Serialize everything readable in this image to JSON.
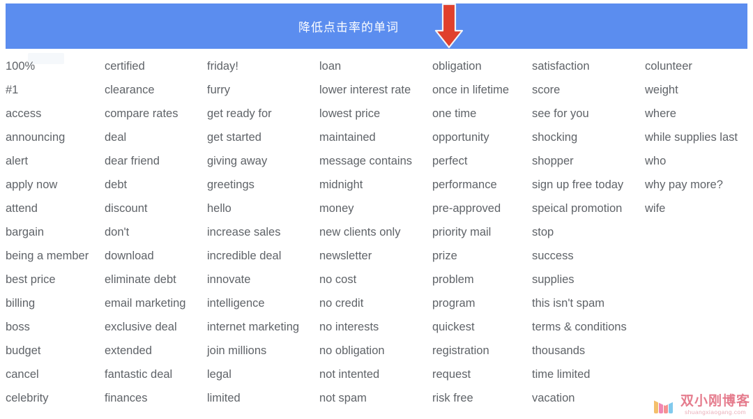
{
  "header": {
    "title": "降低点击率的单词",
    "banner_color": "#5b8def",
    "arrow_color": "#e0402c",
    "arrow_icon": "arrow-down-icon",
    "title_color": "#ffffff"
  },
  "word_list": {
    "text_color": "#5f6368",
    "columns": [
      {
        "index": 1,
        "words": [
          "100%",
          "#1",
          "access",
          "announcing",
          "alert",
          "apply now",
          "attend",
          "bargain",
          "being a member",
          "best price",
          "billing",
          "boss",
          "budget",
          "cancel",
          "celebrity"
        ]
      },
      {
        "index": 2,
        "words": [
          "certified",
          "clearance",
          "compare rates",
          "deal",
          "dear friend",
          "debt",
          "discount",
          "don't",
          "download",
          "eliminate debt",
          "email marketing",
          "exclusive deal",
          "extended",
          "fantastic deal",
          "finances"
        ]
      },
      {
        "index": 3,
        "words": [
          "friday!",
          "furry",
          "get ready for",
          "get started",
          "giving away",
          "greetings",
          "hello",
          "increase sales",
          "incredible deal",
          "innovate",
          "intelligence",
          "internet marketing",
          "join millions",
          "legal",
          "limited"
        ]
      },
      {
        "index": 4,
        "words": [
          "loan",
          "lower interest rate",
          "lowest price",
          "maintained",
          "message contains",
          "midnight",
          "money",
          "new clients only",
          "newsletter",
          "no cost",
          "no credit",
          "no interests",
          "no obligation",
          "not intented",
          "not spam"
        ]
      },
      {
        "index": 5,
        "words": [
          "obligation",
          "once in lifetime",
          "one time",
          "opportunity",
          "perfect",
          "performance",
          "pre-approved",
          "priority mail",
          "prize",
          "problem",
          "program",
          "quickest",
          "registration",
          "request",
          "risk free"
        ]
      },
      {
        "index": 6,
        "words": [
          "satisfaction",
          "score",
          "see for you",
          "shocking",
          "shopper",
          "sign up free today",
          "speical promotion",
          "stop",
          "success",
          "supplies",
          "this isn't spam",
          "terms & conditions",
          "thousands",
          "time limited",
          "vacation"
        ]
      },
      {
        "index": 7,
        "words": [
          "colunteer",
          "weight",
          "where",
          "while supplies last",
          "who",
          "why pay more?",
          "wife"
        ]
      }
    ]
  },
  "watermark": {
    "brand_cn": "双小刚博客",
    "url": "shuangxiaogang.com",
    "logo_icon": "w-logo-icon"
  }
}
